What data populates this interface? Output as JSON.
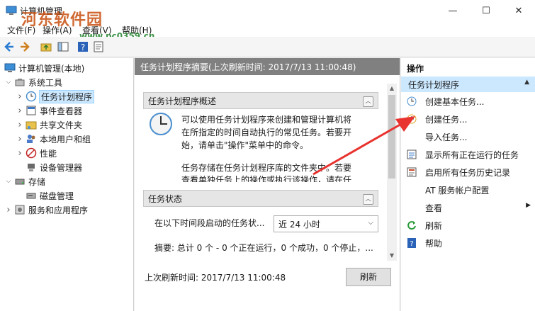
{
  "window": {
    "title": "计算机管理",
    "watermark": "河东软件园",
    "watermark_url": "www.pc0359.cn",
    "min_glyph": "—",
    "max_glyph": "☐",
    "close_glyph": "✕"
  },
  "menu": [
    "文件(F)",
    "操作(A)",
    "查看(V)",
    "帮助(H)"
  ],
  "tree": {
    "root": "计算机管理(本地)",
    "items": [
      {
        "label": "系统工具",
        "level": 1,
        "expanded": true,
        "icon": "tools-icon"
      },
      {
        "label": "任务计划程序",
        "level": 2,
        "expanded": false,
        "icon": "clock-icon",
        "selected": true
      },
      {
        "label": "事件查看器",
        "level": 2,
        "expanded": false,
        "icon": "event-viewer-icon"
      },
      {
        "label": "共享文件夹",
        "level": 2,
        "expanded": false,
        "icon": "shared-folder-icon"
      },
      {
        "label": "本地用户和组",
        "level": 2,
        "expanded": false,
        "icon": "users-icon"
      },
      {
        "label": "性能",
        "level": 2,
        "expanded": false,
        "icon": "performance-icon"
      },
      {
        "label": "设备管理器",
        "level": 2,
        "leaf": true,
        "icon": "device-manager-icon"
      },
      {
        "label": "存储",
        "level": 1,
        "expanded": true,
        "icon": "storage-icon"
      },
      {
        "label": "磁盘管理",
        "level": 2,
        "leaf": true,
        "icon": "disk-icon"
      },
      {
        "label": "服务和应用程序",
        "level": 1,
        "expanded": false,
        "icon": "services-icon"
      }
    ]
  },
  "middle": {
    "header": "任务计划程序摘要(上次刷新时间: 2017/7/13 11:00:48)",
    "overview_title": "任务计划程序概述",
    "overview_lines": [
      "可以使用任务计划程序来创建和管理计算机将",
      "在所指定的时间自动执行的常见任务。若要开",
      "始，请单击\"操作\"菜单中的命令。",
      "",
      "任务存储在任务计划程序库的文件夹中。若要",
      "查看单独任务上的操作或执行该操作，请在任"
    ],
    "status_title": "任务状态",
    "status_label": "在以下时间段启动的任务状...",
    "status_select": "近 24 小时",
    "summary": "摘要: 总计 0 个 - 0 个正在运行，0 个成功，0 个停止，...",
    "last_refresh": "上次刷新时间: 2017/7/13 11:00:48",
    "refresh_button": "刷新"
  },
  "actions": {
    "title": "操作",
    "section": "任务计划程序",
    "items": [
      {
        "label": "创建基本任务...",
        "icon": "basic-task-icon"
      },
      {
        "label": "创建任务...",
        "icon": "create-task-icon"
      },
      {
        "label": "导入任务...",
        "icon": "none"
      },
      {
        "label": "显示所有正在运行的任务",
        "icon": "running-tasks-icon"
      },
      {
        "label": "启用所有任务历史记录",
        "icon": "history-icon"
      },
      {
        "label": "AT 服务帐户配置",
        "icon": "none"
      },
      {
        "label": "查看",
        "icon": "none",
        "submenu": true
      },
      {
        "label": "刷新",
        "icon": "refresh-icon"
      },
      {
        "label": "帮助",
        "icon": "help-icon"
      }
    ]
  },
  "colors": {
    "selection": "#cce8ff",
    "header_gray": "#808080",
    "arrow": "#e8332f"
  }
}
